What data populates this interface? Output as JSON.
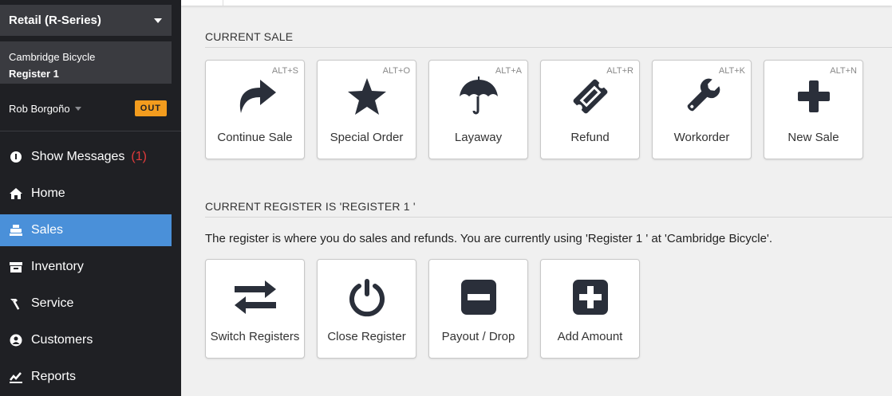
{
  "sidebar": {
    "store_selector": "Retail (R-Series)",
    "shop_name": "Cambridge Bicycle",
    "register_name": "Register 1",
    "user_name": "Rob Borgoño",
    "out_label": "OUT",
    "nav": [
      {
        "label": "Show Messages",
        "icon": "info-icon",
        "count": "(1)"
      },
      {
        "label": "Home",
        "icon": "home-icon"
      },
      {
        "label": "Sales",
        "icon": "register-icon",
        "active": true
      },
      {
        "label": "Inventory",
        "icon": "inventory-icon"
      },
      {
        "label": "Service",
        "icon": "hammer-icon"
      },
      {
        "label": "Customers",
        "icon": "customer-icon"
      },
      {
        "label": "Reports",
        "icon": "chart-icon"
      }
    ]
  },
  "current_sale": {
    "title": "CURRENT SALE",
    "tiles": [
      {
        "label": "Continue Sale",
        "shortcut": "ALT+S",
        "icon": "share-arrow-icon"
      },
      {
        "label": "Special Order",
        "shortcut": "ALT+O",
        "icon": "star-icon"
      },
      {
        "label": "Layaway",
        "shortcut": "ALT+A",
        "icon": "umbrella-icon"
      },
      {
        "label": "Refund",
        "shortcut": "ALT+R",
        "icon": "ticket-icon"
      },
      {
        "label": "Workorder",
        "shortcut": "ALT+K",
        "icon": "wrench-icon"
      },
      {
        "label": "New Sale",
        "shortcut": "ALT+N",
        "icon": "plus-icon"
      }
    ]
  },
  "current_register": {
    "title": "CURRENT REGISTER IS 'REGISTER 1 '",
    "description": "The register is where you do sales and refunds. You are currently using 'Register 1 '  at 'Cambridge Bicycle'.",
    "tiles": [
      {
        "label": "Switch Registers",
        "icon": "switch-arrows-icon"
      },
      {
        "label": "Close Register",
        "icon": "power-icon"
      },
      {
        "label": "Payout / Drop",
        "icon": "minus-square-icon"
      },
      {
        "label": "Add Amount",
        "icon": "plus-square-icon"
      }
    ]
  },
  "colors": {
    "sidebar_bg": "#1f2024",
    "sidebar_panel": "#3a3b40",
    "active_nav": "#4a90d9",
    "out_button": "#f39c1e",
    "icon_dark": "#2a2f3a",
    "message_count": "#e23b3b"
  }
}
